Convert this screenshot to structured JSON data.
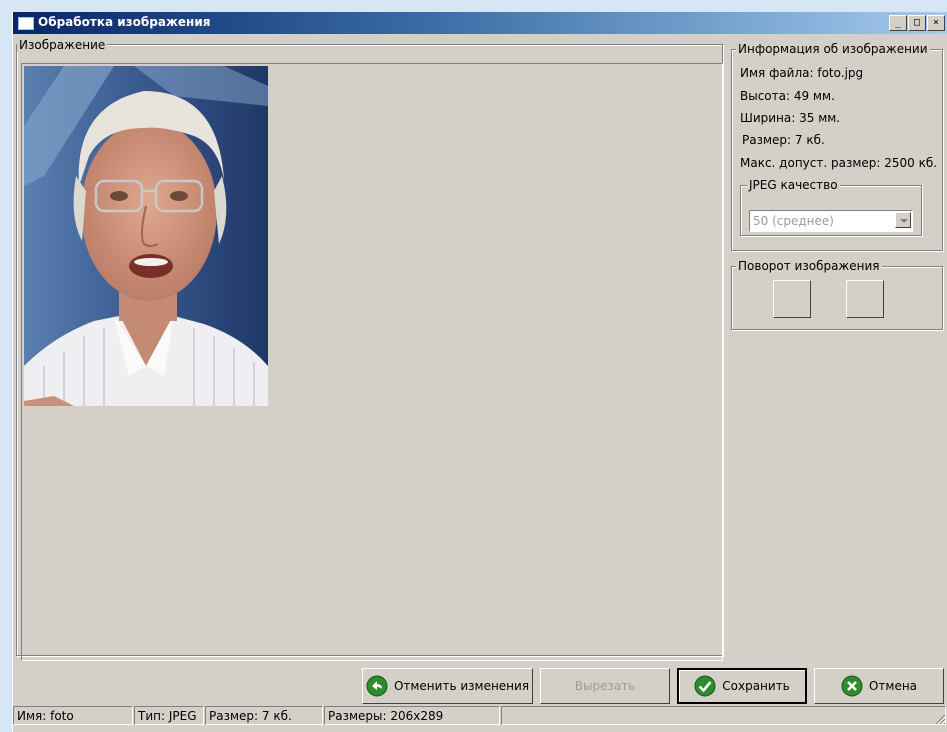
{
  "window": {
    "title": "Обработка изображения",
    "controls": {
      "minimize": "_",
      "maximize": "□",
      "close": "×"
    }
  },
  "image_group": {
    "legend": "Изображение",
    "photo_icon": "portrait-photo"
  },
  "info": {
    "legend": "Информация об изображении",
    "file_name": "Имя файла: foto.jpg",
    "height": "Высота: 49 мм.",
    "width": "Ширина: 35 мм.",
    "size": "Размер: 7 кб.",
    "max_size": "Макс. допуст. размер: 2500 кб.",
    "jpeg": {
      "legend": "JPEG качество",
      "selected": "50 (среднее)"
    }
  },
  "rotation": {
    "legend": "Поворот изображения"
  },
  "buttons": {
    "undo": "Отменить изменения",
    "crop": "Вырезать",
    "save": "Сохранить",
    "cancel": "Отмена"
  },
  "statusbar": {
    "name": "Имя: foto",
    "type": "Тип: JPEG",
    "size": "Размер: 7 кб.",
    "dimensions": "Размеры: 206x289",
    "extra": ""
  },
  "colors": {
    "titlebar_start": "#0a246a",
    "titlebar_end": "#a6caf0",
    "face": "#d4d0c8",
    "icon_green": "#2e8b2e"
  }
}
